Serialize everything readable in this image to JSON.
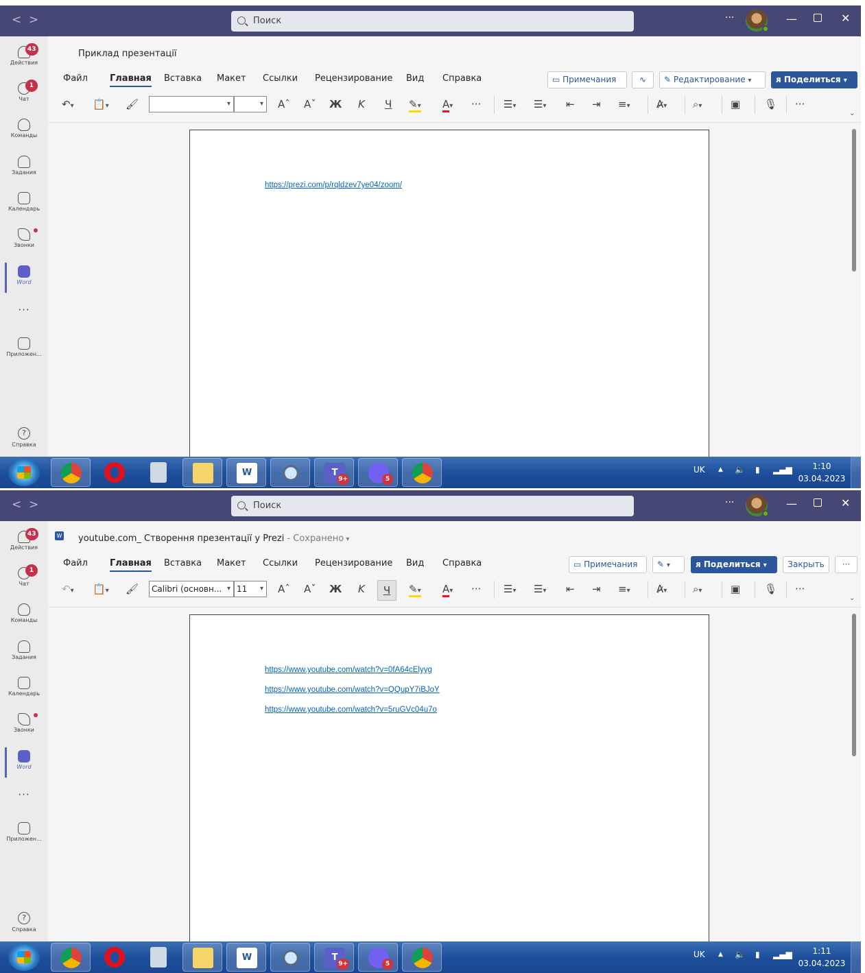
{
  "search_placeholder": "Поиск",
  "rail": {
    "activity": {
      "label": "Действия",
      "badge": "43"
    },
    "chat": {
      "label": "Чат",
      "badge": "1"
    },
    "teams": {
      "label": "Команды"
    },
    "assignments": {
      "label": "Задания"
    },
    "calendar": {
      "label": "Календарь"
    },
    "calls": {
      "label": "Звонки"
    },
    "word": {
      "label": "Word"
    },
    "more": "···",
    "apps": {
      "label": "Приложен..."
    },
    "help": {
      "label": "Справка"
    }
  },
  "tabs": [
    "Файл",
    "Главная",
    "Вставка",
    "Макет",
    "Ссылки",
    "Рецензирование",
    "Вид",
    "Справка"
  ],
  "ribbon": {
    "grow": "A",
    "shrink": "A",
    "bold": "Ж",
    "italic": "K",
    "underline": "Ч",
    "highlight": "A",
    "more": "···"
  },
  "shot1": {
    "doc_title": "Приклад презентації",
    "comments_label": "Примечания",
    "editing_label": "Редактирование",
    "share_label": "Поделиться",
    "font_name": "",
    "font_size": "",
    "links": [
      "https://prezi.com/p/rqldzev7ye04/zoom/"
    ],
    "clock_time": "1:10",
    "clock_date": "03.04.2023"
  },
  "shot2": {
    "doc_title": "youtube.com_ Створення презентації у Prezi",
    "saved_label": "- Сохранено",
    "comments_label": "Примечания",
    "share_label": "Поделиться",
    "close_label": "Закрыть",
    "more_label": "···",
    "font_name": "Calibri (основн...",
    "font_size": "11",
    "links": [
      "https://www.youtube.com/watch?v=0fA64cElyyg",
      "https://www.youtube.com/watch?v=QQupY7iBJoY",
      "https://www.youtube.com/watch?v=5ruGVc04u7o"
    ],
    "clock_time": "1:11",
    "clock_date": "03.04.2023"
  },
  "taskbar": {
    "language": "UK",
    "teams_badge": "9+",
    "viber_badge": "5"
  },
  "colors": {
    "title_bar": "#464775",
    "accent": "#5b5fc7",
    "word_blue": "#2b579a",
    "link": "#0563c1",
    "badge": "#c4314b"
  }
}
